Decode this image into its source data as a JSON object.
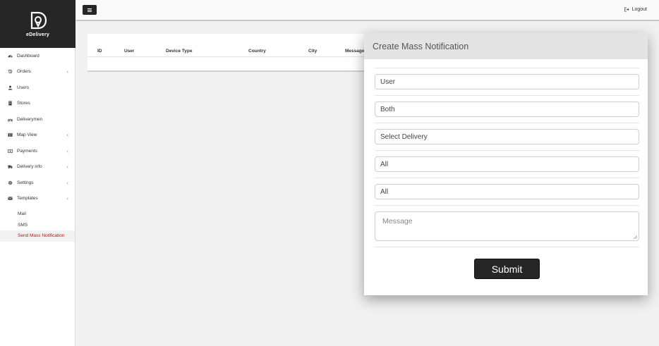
{
  "brand": {
    "name": "eDelivery"
  },
  "header": {
    "logout_label": "Logout"
  },
  "sidebar": {
    "items": [
      {
        "label": "Dashboard",
        "icon": "dashboard-icon",
        "has_children": false
      },
      {
        "label": "Orders",
        "icon": "history-icon",
        "has_children": true
      },
      {
        "label": "Users",
        "icon": "user-icon",
        "has_children": false
      },
      {
        "label": "Stores",
        "icon": "building-icon",
        "has_children": false
      },
      {
        "label": "Deliverymen",
        "icon": "motorcycle-icon",
        "has_children": false
      },
      {
        "label": "Map View",
        "icon": "map-icon",
        "has_children": true
      },
      {
        "label": "Payments",
        "icon": "money-icon",
        "has_children": true
      },
      {
        "label": "Delivery info",
        "icon": "truck-icon",
        "has_children": true
      },
      {
        "label": "Settings",
        "icon": "gear-icon",
        "has_children": true
      },
      {
        "label": "Templates",
        "icon": "envelope-icon",
        "has_children": true
      }
    ],
    "sub_items": [
      {
        "label": "Mail",
        "active": false
      },
      {
        "label": "SMS",
        "active": false
      },
      {
        "label": "Send Mass Notification",
        "active": true
      }
    ],
    "active_color": "#a4171c"
  },
  "table": {
    "columns": [
      "ID",
      "User",
      "Device Type",
      "Country",
      "City",
      "Message"
    ]
  },
  "modal": {
    "title": "Create Mass Notification",
    "fields": [
      {
        "name": "user-type-select",
        "value": "User"
      },
      {
        "name": "device-type-select",
        "value": "Both"
      },
      {
        "name": "delivery-select",
        "value": "Select Delivery"
      },
      {
        "name": "country-select",
        "value": "All"
      },
      {
        "name": "city-select",
        "value": "All"
      }
    ],
    "message_placeholder": "Message",
    "submit_label": "Submit"
  }
}
